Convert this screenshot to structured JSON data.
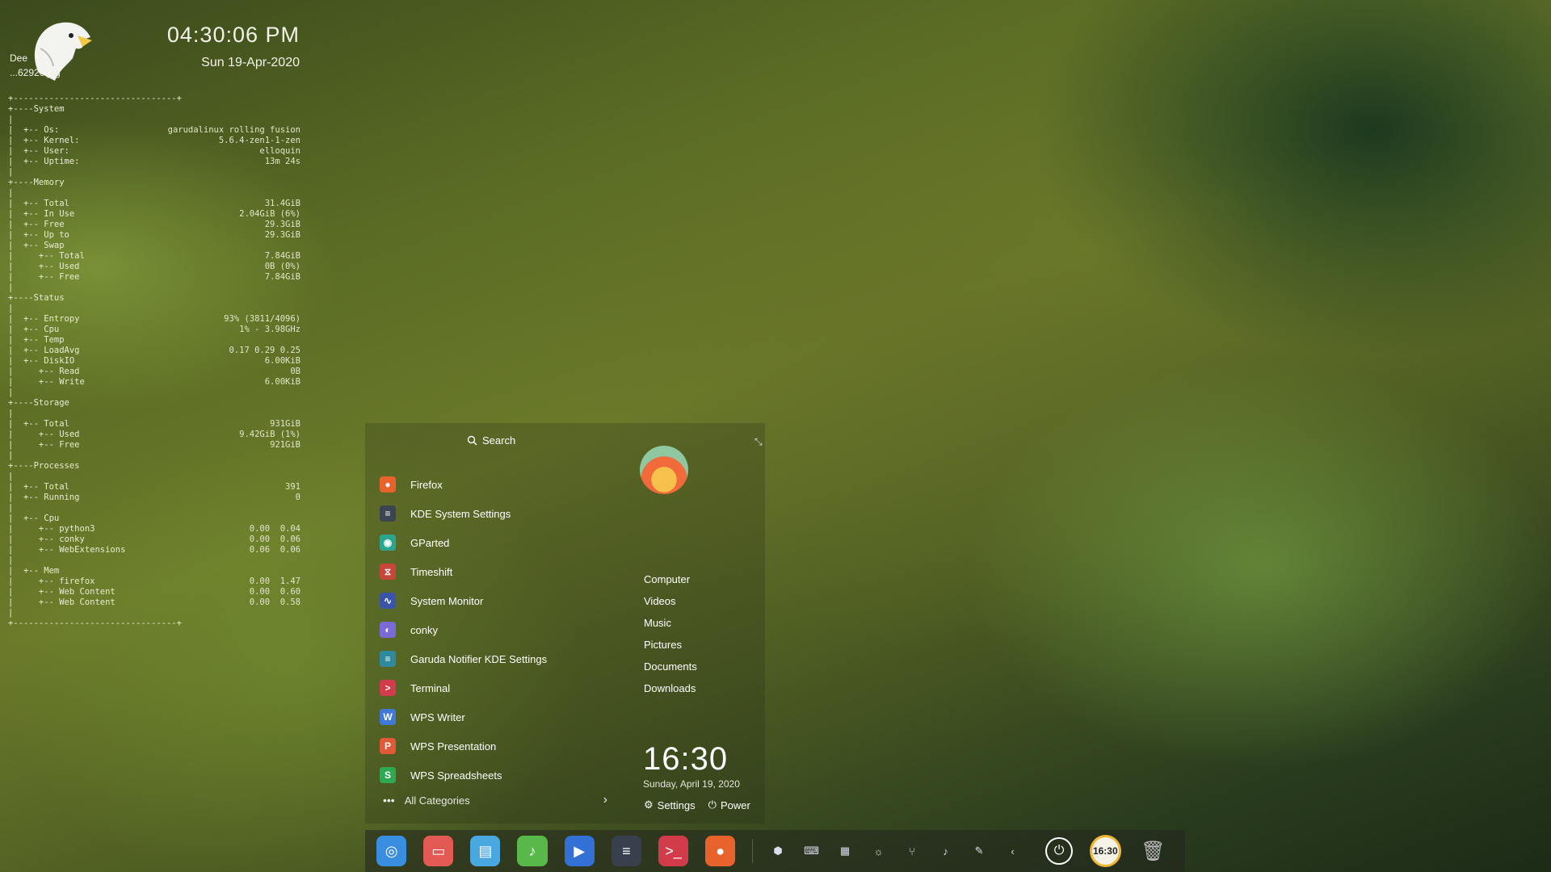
{
  "desktop": {
    "clock": {
      "time": "04:30:06 PM",
      "date": "Sun 19-Apr-2020"
    },
    "eagle_text": {
      "line1": "Dee",
      "line2": "...62920.jpg"
    }
  },
  "conky": {
    "rows": [
      {
        "l": "+--------------------------------+",
        "r": ""
      },
      {
        "l": "+----System",
        "r": ""
      },
      {
        "l": "|",
        "r": ""
      },
      {
        "l": "|  +-- Os:",
        "r": "garudalinux rolling fusion"
      },
      {
        "l": "|  +-- Kernel:",
        "r": "5.6.4-zen1-1-zen"
      },
      {
        "l": "|  +-- User:",
        "r": "elloquin"
      },
      {
        "l": "|  +-- Uptime:",
        "r": "13m 24s"
      },
      {
        "l": "|",
        "r": ""
      },
      {
        "l": "+----Memory",
        "r": ""
      },
      {
        "l": "|",
        "r": ""
      },
      {
        "l": "|  +-- Total",
        "r": "31.4GiB"
      },
      {
        "l": "|  +-- In Use",
        "r": "2.04GiB (6%)"
      },
      {
        "l": "|  +-- Free",
        "r": "29.3GiB"
      },
      {
        "l": "|  +-- Up to",
        "r": "29.3GiB"
      },
      {
        "l": "|  +-- Swap",
        "r": ""
      },
      {
        "l": "|     +-- Total",
        "r": "7.84GiB"
      },
      {
        "l": "|     +-- Used",
        "r": "0B (0%)"
      },
      {
        "l": "|     +-- Free",
        "r": "7.84GiB"
      },
      {
        "l": "|",
        "r": ""
      },
      {
        "l": "+----Status",
        "r": ""
      },
      {
        "l": "|",
        "r": ""
      },
      {
        "l": "|  +-- Entropy",
        "r": "93% (3811/4096)"
      },
      {
        "l": "|  +-- Cpu",
        "r": "1% - 3.98GHz"
      },
      {
        "l": "|  +-- Temp",
        "r": ""
      },
      {
        "l": "|  +-- LoadAvg",
        "r": "0.17 0.29 0.25"
      },
      {
        "l": "|  +-- DiskIO",
        "r": "6.00KiB"
      },
      {
        "l": "|     +-- Read",
        "r": "0B"
      },
      {
        "l": "|     +-- Write",
        "r": "6.00KiB"
      },
      {
        "l": "|",
        "r": ""
      },
      {
        "l": "+----Storage",
        "r": ""
      },
      {
        "l": "|",
        "r": ""
      },
      {
        "l": "|  +-- Total",
        "r": "931GiB"
      },
      {
        "l": "|     +-- Used",
        "r": "9.42GiB (1%)"
      },
      {
        "l": "|     +-- Free",
        "r": "921GiB"
      },
      {
        "l": "|",
        "r": ""
      },
      {
        "l": "+----Processes",
        "r": ""
      },
      {
        "l": "|",
        "r": ""
      },
      {
        "l": "|  +-- Total",
        "r": "391"
      },
      {
        "l": "|  +-- Running",
        "r": "0"
      },
      {
        "l": "|",
        "r": ""
      },
      {
        "l": "|  +-- Cpu",
        "r": ""
      },
      {
        "l": "|     +-- python3",
        "r": "0.00  0.04"
      },
      {
        "l": "|     +-- conky",
        "r": "0.00  0.06"
      },
      {
        "l": "|     +-- WebExtensions",
        "r": "0.06  0.06"
      },
      {
        "l": "|",
        "r": ""
      },
      {
        "l": "|  +-- Mem",
        "r": ""
      },
      {
        "l": "|     +-- firefox",
        "r": "0.00  1.47"
      },
      {
        "l": "|     +-- Web Content",
        "r": "0.00  0.60"
      },
      {
        "l": "|     +-- Web Content",
        "r": "0.00  0.58"
      },
      {
        "l": "|",
        "r": ""
      },
      {
        "l": "+--------------------------------+",
        "r": ""
      }
    ]
  },
  "menu": {
    "search_label": "Search",
    "apps": [
      {
        "label": "Firefox",
        "icon": "firefox-icon",
        "color": "#e8622c",
        "glyph": "●"
      },
      {
        "label": "KDE System Settings",
        "icon": "settings-icon",
        "color": "#3c4452",
        "glyph": "≡"
      },
      {
        "label": "GParted",
        "icon": "gparted-icon",
        "color": "#2aa58e",
        "glyph": "◉"
      },
      {
        "label": "Timeshift",
        "icon": "timeshift-icon",
        "color": "#c8453a",
        "glyph": "⧖"
      },
      {
        "label": "System Monitor",
        "icon": "system-monitor-icon",
        "color": "#3a55a8",
        "glyph": "∿"
      },
      {
        "label": "conky",
        "icon": "conky-icon",
        "color": "#7a6ad8",
        "glyph": "◐"
      },
      {
        "label": "Garuda Notifier KDE Settings",
        "icon": "garuda-notifier-icon",
        "color": "#2f8a9e",
        "glyph": "≡"
      },
      {
        "label": "Terminal",
        "icon": "terminal-icon",
        "color": "#d23c4a",
        "glyph": ">"
      },
      {
        "label": "WPS Writer",
        "icon": "wps-writer-icon",
        "color": "#3f7ad8",
        "glyph": "W"
      },
      {
        "label": "WPS Presentation",
        "icon": "wps-presentation-icon",
        "color": "#e05a3a",
        "glyph": "P"
      },
      {
        "label": "WPS Spreadsheets",
        "icon": "wps-spreadsheets-icon",
        "color": "#2fa852",
        "glyph": "S"
      }
    ],
    "all_categories": "All Categories",
    "places": [
      "Computer",
      "Videos",
      "Music",
      "Pictures",
      "Documents",
      "Downloads"
    ],
    "time": "16:30",
    "date": "Sunday, April 19, 2020",
    "settings_label": "Settings",
    "power_label": "Power"
  },
  "dock": {
    "apps": [
      {
        "name": "garuda-launcher-icon",
        "color": "#3a8ee0",
        "glyph": "◎"
      },
      {
        "name": "presentation-app-icon",
        "color": "#e35a55",
        "glyph": "▭"
      },
      {
        "name": "file-manager-icon",
        "color": "#4aa8e0",
        "glyph": "▤"
      },
      {
        "name": "music-player-icon",
        "color": "#58b84a",
        "glyph": "♪"
      },
      {
        "name": "video-player-icon",
        "color": "#3370d6",
        "glyph": "▶"
      },
      {
        "name": "system-settings-icon",
        "color": "#38404e",
        "glyph": "≡"
      },
      {
        "name": "terminal-icon",
        "color": "#d23c4a",
        "glyph": ">_"
      },
      {
        "name": "firefox-icon",
        "color": "#e8622c",
        "glyph": "●"
      }
    ],
    "tray": [
      {
        "name": "security-shield-icon",
        "glyph": "⬢"
      },
      {
        "name": "keyboard-icon",
        "glyph": "⌨"
      },
      {
        "name": "clipboard-icon",
        "glyph": "▦"
      },
      {
        "name": "brightness-icon",
        "glyph": "☼"
      },
      {
        "name": "usb-icon",
        "glyph": "⑂"
      },
      {
        "name": "volume-icon",
        "glyph": "♪"
      },
      {
        "name": "pen-icon",
        "glyph": "✎"
      },
      {
        "name": "expand-tray-icon",
        "glyph": "‹"
      }
    ],
    "clock_badge": "16:30"
  }
}
